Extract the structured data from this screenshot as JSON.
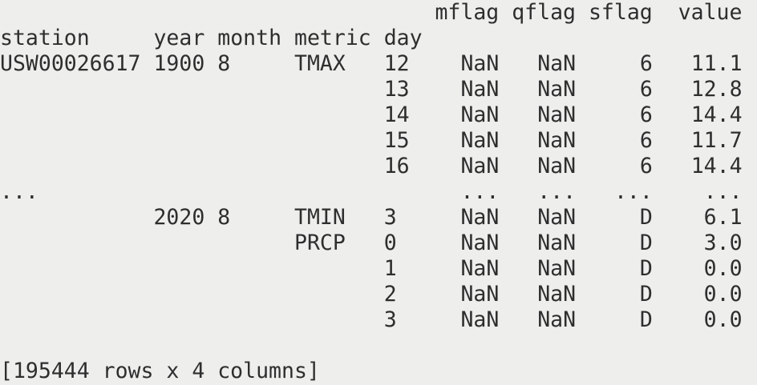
{
  "header": {
    "value_columns": [
      "mflag",
      "qflag",
      "sflag",
      "value"
    ],
    "index_names": [
      "station",
      "year",
      "month",
      "metric",
      "day"
    ]
  },
  "rows": [
    {
      "station": "USW00026617",
      "year": "1900",
      "month": "8",
      "metric": "TMAX",
      "day": "12",
      "mflag": "NaN",
      "qflag": "NaN",
      "sflag": "6",
      "value": "11.1"
    },
    {
      "station": "",
      "year": "",
      "month": "",
      "metric": "",
      "day": "13",
      "mflag": "NaN",
      "qflag": "NaN",
      "sflag": "6",
      "value": "12.8"
    },
    {
      "station": "",
      "year": "",
      "month": "",
      "metric": "",
      "day": "14",
      "mflag": "NaN",
      "qflag": "NaN",
      "sflag": "6",
      "value": "14.4"
    },
    {
      "station": "",
      "year": "",
      "month": "",
      "metric": "",
      "day": "15",
      "mflag": "NaN",
      "qflag": "NaN",
      "sflag": "6",
      "value": "11.7"
    },
    {
      "station": "",
      "year": "",
      "month": "",
      "metric": "",
      "day": "16",
      "mflag": "NaN",
      "qflag": "NaN",
      "sflag": "6",
      "value": "14.4"
    },
    {
      "station": "...",
      "year": "",
      "month": "",
      "metric": "",
      "day": "",
      "mflag": "...",
      "qflag": "...",
      "sflag": "...",
      "value": "..."
    },
    {
      "station": "",
      "year": "2020",
      "month": "8",
      "metric": "TMIN",
      "day": "3",
      "mflag": "NaN",
      "qflag": "NaN",
      "sflag": "D",
      "value": "6.1"
    },
    {
      "station": "",
      "year": "",
      "month": "",
      "metric": "PRCP",
      "day": "0",
      "mflag": "NaN",
      "qflag": "NaN",
      "sflag": "D",
      "value": "3.0"
    },
    {
      "station": "",
      "year": "",
      "month": "",
      "metric": "",
      "day": "1",
      "mflag": "NaN",
      "qflag": "NaN",
      "sflag": "D",
      "value": "0.0"
    },
    {
      "station": "",
      "year": "",
      "month": "",
      "metric": "",
      "day": "2",
      "mflag": "NaN",
      "qflag": "NaN",
      "sflag": "D",
      "value": "0.0"
    },
    {
      "station": "",
      "year": "",
      "month": "",
      "metric": "",
      "day": "3",
      "mflag": "NaN",
      "qflag": "NaN",
      "sflag": "D",
      "value": "0.0"
    }
  ],
  "footer": {
    "summary": "[195444 rows x 4 columns]"
  }
}
